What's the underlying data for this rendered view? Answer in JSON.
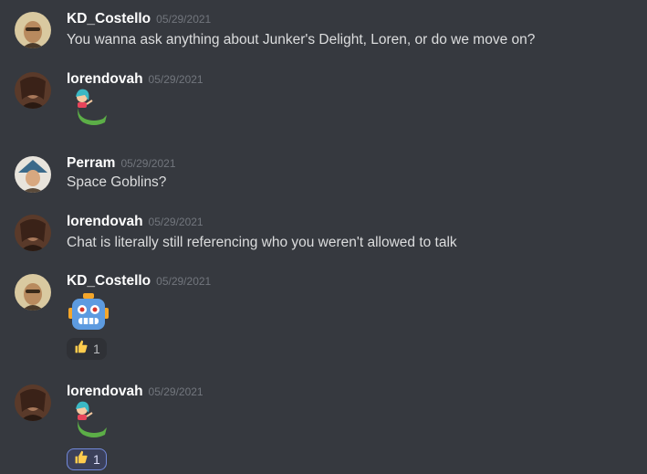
{
  "messages": [
    {
      "username": "KD_Costello",
      "timestamp": "05/29/2021",
      "text": "You wanna ask anything about Junker's Delight, Loren, or do we move on?"
    },
    {
      "username": "lorendovah",
      "timestamp": "05/29/2021",
      "emoji": "mermaid-emoji"
    },
    {
      "username": "Perram",
      "timestamp": "05/29/2021",
      "text": "Space Goblins?"
    },
    {
      "username": "lorendovah",
      "timestamp": "05/29/2021",
      "text": "Chat is literally still referencing who you weren't allowed to talk"
    },
    {
      "username": "KD_Costello",
      "timestamp": "05/29/2021",
      "emoji": "robot-emoji",
      "reaction": {
        "emoji": "thumbs-up-emoji",
        "count": "1",
        "active": false
      }
    },
    {
      "username": "lorendovah",
      "timestamp": "05/29/2021",
      "emoji": "mermaid-emoji",
      "reaction": {
        "emoji": "thumbs-up-emoji",
        "count": "1",
        "active": true
      }
    }
  ],
  "colors": {
    "background": "#36393f",
    "username": "#ffffff",
    "timestamp": "#72767d",
    "text": "#dcddde",
    "reaction_active_border": "#7289da"
  }
}
